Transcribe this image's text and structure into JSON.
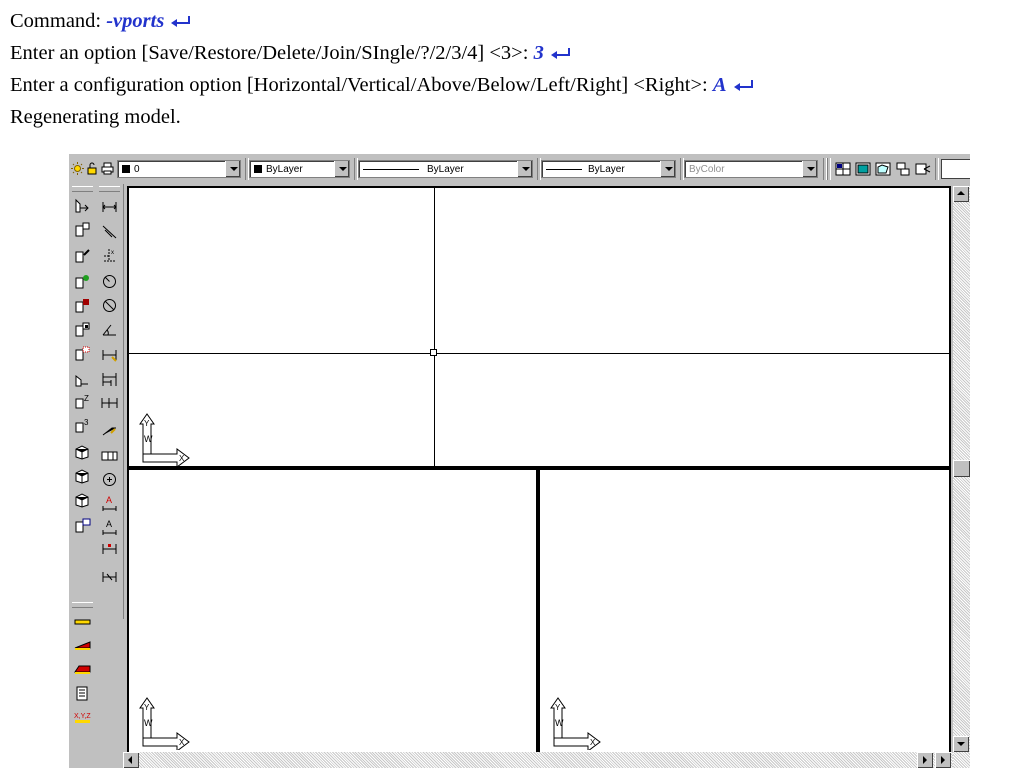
{
  "command_lines": [
    {
      "text": "Command: ",
      "input": "-vports"
    },
    {
      "text": "Enter an option [Save/Restore/Delete/Join/SIngle/?/2/3/4] <3>: ",
      "input": "3"
    },
    {
      "text": "Enter a configuration option [Horizontal/Vertical/Above/Below/Left/Right] <Right>: ",
      "input": "A"
    },
    {
      "text": "Regenerating model.",
      "input": ""
    }
  ],
  "toolbar": {
    "layer_value": "0",
    "color_value": "ByLayer",
    "linetype_value": "ByLayer",
    "lineweight_value": "ByLayer",
    "plotstyle_value": "ByColor"
  },
  "icons": {
    "layer_state": "sun-lock-printer-icons",
    "return": "return-arrow-icon",
    "ucs": "ucs-icon"
  },
  "ucs_labels": {
    "y": "Y",
    "w": "W",
    "x": "X"
  },
  "colors": {
    "input_text": "#2233cc",
    "layer_swatch": "#000000",
    "background": "#ffffff",
    "chrome": "#c0c0c0"
  }
}
